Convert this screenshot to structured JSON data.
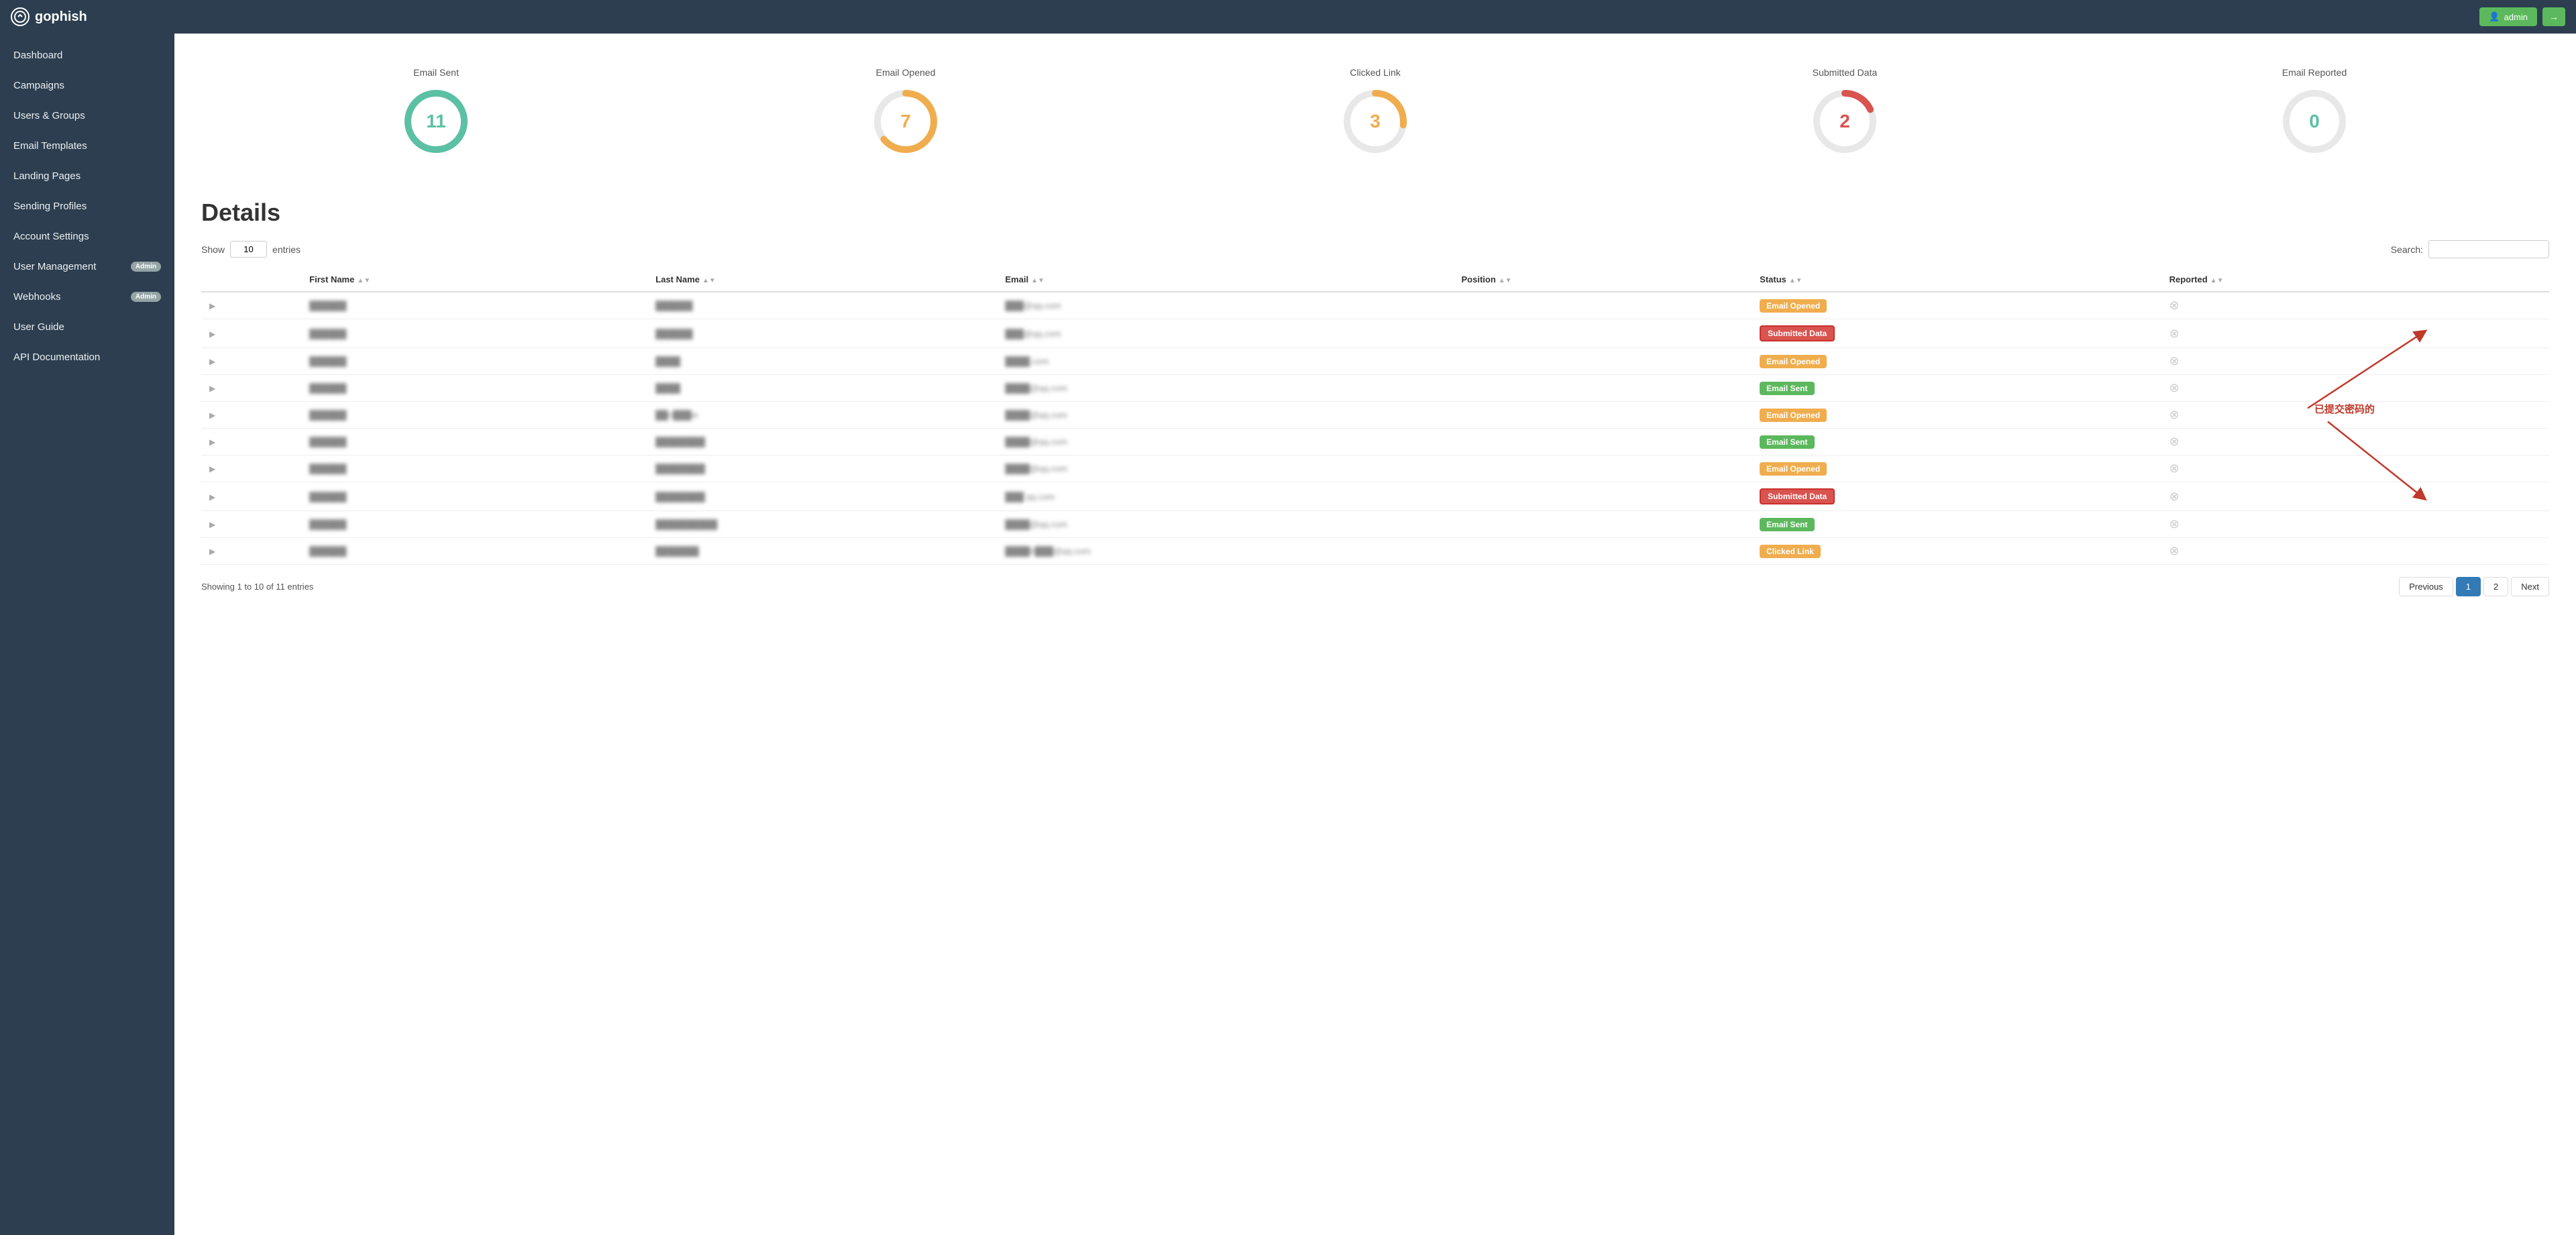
{
  "navbar": {
    "brand": "gophish",
    "admin_label": "admin",
    "logout_icon": "→"
  },
  "sidebar": {
    "items": [
      {
        "id": "dashboard",
        "label": "Dashboard",
        "admin_badge": false
      },
      {
        "id": "campaigns",
        "label": "Campaigns",
        "admin_badge": false
      },
      {
        "id": "users-groups",
        "label": "Users & Groups",
        "admin_badge": false
      },
      {
        "id": "email-templates",
        "label": "Email Templates",
        "admin_badge": false
      },
      {
        "id": "landing-pages",
        "label": "Landing Pages",
        "admin_badge": false
      },
      {
        "id": "sending-profiles",
        "label": "Sending Profiles",
        "admin_badge": false
      },
      {
        "id": "account-settings",
        "label": "Account Settings",
        "admin_badge": false
      },
      {
        "id": "user-management",
        "label": "User Management",
        "admin_badge": true
      },
      {
        "id": "webhooks",
        "label": "Webhooks",
        "admin_badge": true
      },
      {
        "id": "user-guide",
        "label": "User Guide",
        "admin_badge": false
      },
      {
        "id": "api-documentation",
        "label": "API Documentation",
        "admin_badge": false
      }
    ],
    "badge_label": "Admin"
  },
  "stats": [
    {
      "id": "email-sent",
      "label": "Email Sent",
      "value": "11",
      "color": "#5bc0a4",
      "bg": "#eee",
      "percent": 100
    },
    {
      "id": "email-opened",
      "label": "Email Opened",
      "value": "7",
      "color": "#f0ad4e",
      "bg": "#eee",
      "percent": 64
    },
    {
      "id": "clicked-link",
      "label": "Clicked Link",
      "value": "3",
      "color": "#f0ad4e",
      "bg": "#eee",
      "percent": 27
    },
    {
      "id": "submitted-data",
      "label": "Submitted Data",
      "value": "2",
      "color": "#d9534f",
      "bg": "#eee",
      "percent": 18
    },
    {
      "id": "email-reported",
      "label": "Email Reported",
      "value": "0",
      "color": "#5bc0a4",
      "bg": "#eee",
      "percent": 0
    }
  ],
  "details": {
    "title": "Details",
    "show_label": "Show",
    "entries_label": "entries",
    "entries_value": "10",
    "search_label": "Search:",
    "search_placeholder": "",
    "columns": [
      {
        "id": "expand",
        "label": ""
      },
      {
        "id": "first-name",
        "label": "First Name"
      },
      {
        "id": "last-name",
        "label": "Last Name"
      },
      {
        "id": "email",
        "label": "Email"
      },
      {
        "id": "position",
        "label": "Position"
      },
      {
        "id": "status",
        "label": "Status"
      },
      {
        "id": "reported",
        "label": "Reported"
      },
      {
        "id": "delete",
        "label": ""
      }
    ],
    "rows": [
      {
        "first": "",
        "last": "██████",
        "email": "███@qq.com",
        "position": "",
        "status": "Email Opened",
        "status_class": "badge-email-opened",
        "reported": "",
        "highlight": false
      },
      {
        "first": "",
        "last": "██████",
        "email": "███@qq.com",
        "position": "",
        "status": "Submitted Data",
        "status_class": "badge-submitted-data",
        "reported": "",
        "highlight": true
      },
      {
        "first": "",
        "last": "████",
        "email": "████.com",
        "position": "",
        "status": "Email Opened",
        "status_class": "badge-email-opened",
        "reported": "",
        "highlight": false
      },
      {
        "first": "",
        "last": "████",
        "email": "████@qq.com",
        "position": "",
        "status": "Email Sent",
        "status_class": "badge-email-sent",
        "reported": "",
        "highlight": false
      },
      {
        "first": "",
        "last": "██n███ie",
        "email": "████@qq.com",
        "position": "",
        "status": "Email Opened",
        "status_class": "badge-email-opened",
        "reported": "",
        "highlight": false
      },
      {
        "first": "",
        "last": "████████",
        "email": "████@qq.com",
        "position": "",
        "status": "Email Sent",
        "status_class": "badge-email-sent",
        "reported": "",
        "highlight": false
      },
      {
        "first": "",
        "last": "████████",
        "email": "████@qq.com",
        "position": "",
        "status": "Email Opened",
        "status_class": "badge-email-opened",
        "reported": "",
        "highlight": false
      },
      {
        "first": "",
        "last": "████████",
        "email": "███ qq.com",
        "position": "",
        "status": "Submitted Data",
        "status_class": "badge-submitted-data",
        "reported": "",
        "highlight": true
      },
      {
        "first": "",
        "last": "██████████",
        "email": "████@qq.com",
        "position": "",
        "status": "Email Sent",
        "status_class": "badge-email-sent",
        "reported": "",
        "highlight": false
      },
      {
        "first": "",
        "last": "███████",
        "email": "████6███@qq.com",
        "position": "",
        "status": "Clicked Link",
        "status_class": "badge-clicked-link",
        "reported": "",
        "highlight": false
      }
    ],
    "annotation_text": "已提交密码的",
    "showing_text": "Showing 1 to 10 of 11 entries"
  },
  "pagination": {
    "previous_label": "Previous",
    "next_label": "Next",
    "current_page": 1,
    "total_pages": 2
  }
}
